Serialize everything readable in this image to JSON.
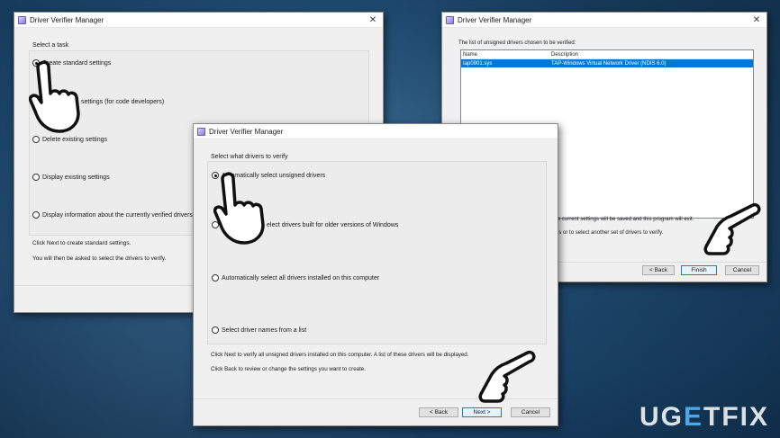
{
  "dialog1": {
    "title": "Driver Verifier Manager",
    "group_label": "Select a task",
    "options": [
      {
        "label": "Create standard settings",
        "checked": true
      },
      {
        "label": "settings (for code developers)",
        "checked": false
      },
      {
        "label": "Delete existing settings",
        "checked": false
      },
      {
        "label": "Display existing settings",
        "checked": false
      },
      {
        "label": "Display information about the currently verified drivers",
        "checked": false
      }
    ],
    "info1": "Click Next to create standard settings.",
    "info2": "You will then be asked to select the drivers to verify."
  },
  "dialog2": {
    "title": "Driver Verifier Manager",
    "group_label": "Select what drivers to verify",
    "options": [
      {
        "label": "Automatically select unsigned drivers",
        "checked": true
      },
      {
        "label": "elect drivers built for older versions of Windows",
        "checked": false
      },
      {
        "label": "Automatically select all drivers installed on this computer",
        "checked": false
      },
      {
        "label": "Select driver names from a list",
        "checked": false
      }
    ],
    "info1": "Click Next to verify all unsigned drivers installed on this computer. A list of these drivers will be displayed.",
    "info2": "Click Back to review or change the settings you want to create.",
    "buttons": {
      "back": "< Back",
      "next": "Next >",
      "cancel": "Cancel"
    }
  },
  "dialog3": {
    "title": "Driver Verifier Manager",
    "group_label": "The list of unsigned drivers chosen to be verified:",
    "columns": [
      "Name",
      "Description"
    ],
    "rows": [
      {
        "name": "tap0901.sys",
        "description": "TAP-Windows Virtual Network Driver (NDIS 6.0)"
      }
    ],
    "info1": "Click Finish to verify this list of drivers. The current settings will be saved and this program will exit.",
    "info2": "Click Back to review or change the settings or to select another set of drivers to verify.",
    "buttons": {
      "back": "< Back",
      "finish": "Finish",
      "cancel": "Cancel"
    }
  },
  "watermark": {
    "part1": "U",
    "part2": "G",
    "accent": "E",
    "part3": "TFIX"
  },
  "colors": {
    "accent": "#0078d7",
    "background": "#1f4a70"
  },
  "icons": [
    "close-icon",
    "app-icon",
    "pointer-hand-icon"
  ]
}
